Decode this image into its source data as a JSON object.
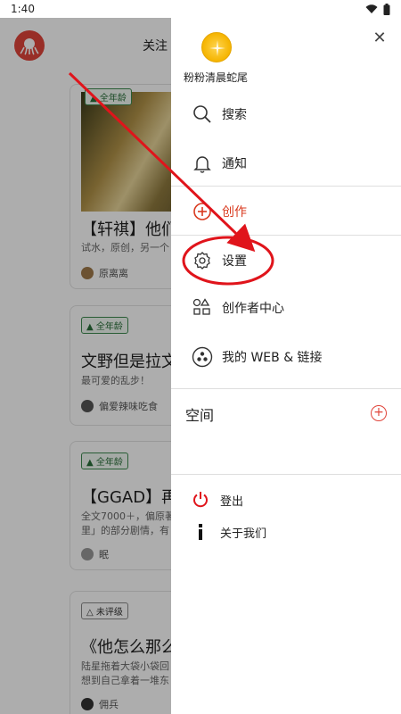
{
  "status_bar": {
    "time": "1:40"
  },
  "app": {
    "header": {
      "tab_follow": "关注"
    },
    "cards": [
      {
        "rating": "全年龄",
        "title": "【轩祺】他们",
        "excerpt": "试水，原创，另一个",
        "author": "原离离",
        "has_image": true
      },
      {
        "rating": "全年龄",
        "title": "文野但是拉文",
        "excerpt": "最可爱的乱步！",
        "author": "偏爱辣味吃食",
        "has_image": false
      },
      {
        "rating": "全年龄",
        "title": "【GGAD】再",
        "excerpt_lines": [
          "全文7000＋，偏原著",
          "里」的部分剧情，有"
        ],
        "author": "眠",
        "has_image": false
      },
      {
        "rating": "未评级",
        "title": "《他怎么那么",
        "excerpt_lines": [
          "陆星拖着大袋小袋回",
          "想到自己拿着一堆东"
        ],
        "author": "佣兵",
        "has_image": false
      }
    ]
  },
  "drawer": {
    "user_name": "粉粉清晨蛇尾",
    "menu": [
      {
        "id": "search",
        "label": "搜索",
        "icon": "search-icon"
      },
      {
        "id": "notifications",
        "label": "通知",
        "icon": "bell-icon"
      },
      {
        "id": "create",
        "label": "创作",
        "icon": "plus-circle-icon"
      },
      {
        "id": "settings",
        "label": "设置",
        "icon": "gear-icon"
      },
      {
        "id": "creator-center",
        "label": "创作者中心",
        "icon": "shapes-icon"
      },
      {
        "id": "web-links",
        "label": "我的 WEB & 链接",
        "icon": "link-circle-icon"
      }
    ],
    "space_label": "空间",
    "bottom": [
      {
        "id": "logout",
        "label": "登出",
        "icon": "power-icon"
      },
      {
        "id": "about",
        "label": "关于我们",
        "icon": "info-icon"
      }
    ]
  },
  "colors": {
    "accent": "#e0443a",
    "annotation_red": "#e0141b",
    "rating_green": "#2a6f3a"
  }
}
